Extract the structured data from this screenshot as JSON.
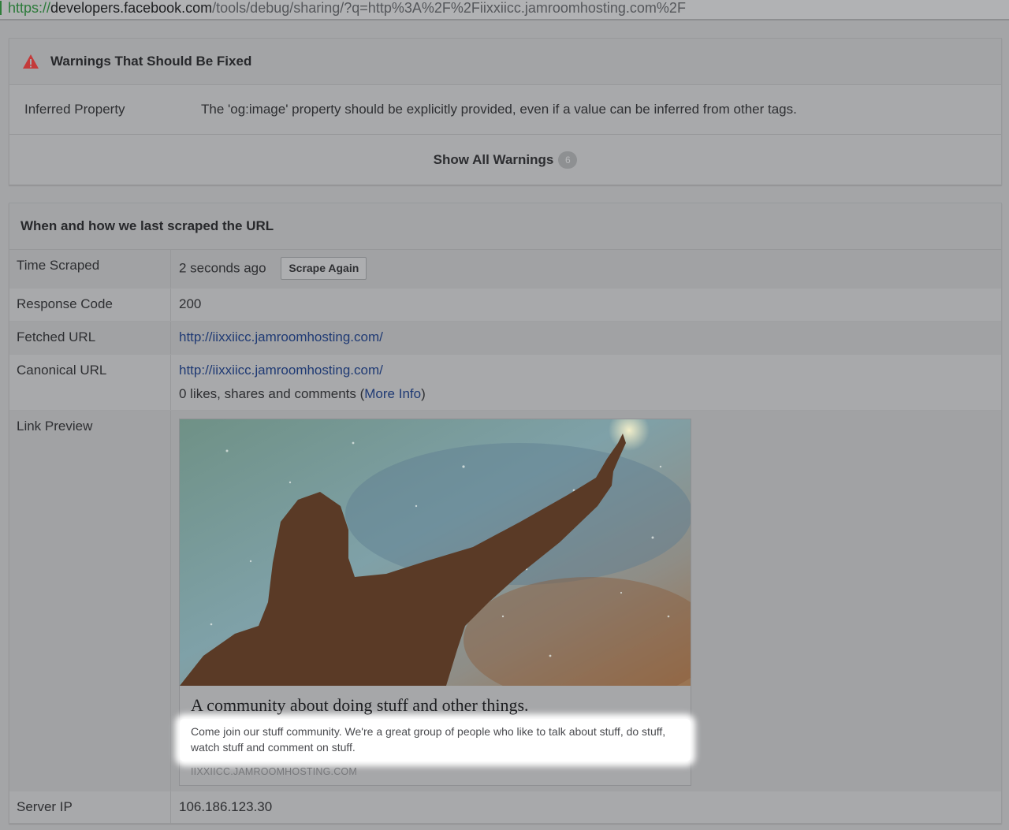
{
  "url_bar": {
    "scheme": "https://",
    "host": "developers.facebook.com",
    "path": "/tools/debug/sharing/?q=http%3A%2F%2Fiixxiicc.jamroomhosting.com%2F"
  },
  "warnings": {
    "title": "Warnings That Should Be Fixed",
    "icon": "warning-triangle-icon",
    "icon_color": "#c43a3a",
    "items": [
      {
        "label": "Inferred Property",
        "message": "The 'og:image' property should be explicitly provided, even if a value can be inferred from other tags."
      }
    ],
    "show_all_label": "Show All Warnings",
    "count": "6"
  },
  "scrape": {
    "title": "When and how we last scraped the URL",
    "time_scraped": {
      "label": "Time Scraped",
      "value": "2 seconds ago",
      "button": "Scrape Again"
    },
    "response_code": {
      "label": "Response Code",
      "value": "200"
    },
    "fetched_url": {
      "label": "Fetched URL",
      "value": "http://iixxiicc.jamroomhosting.com/"
    },
    "canonical_url": {
      "label": "Canonical URL",
      "value": "http://iixxiicc.jamroomhosting.com/",
      "likes_prefix": "0 likes, shares and comments (",
      "more_info": "More Info",
      "likes_suffix": ")"
    },
    "link_preview": {
      "label": "Link Preview",
      "title": "A community about doing stuff and other things.",
      "description": "Come join our stuff community. We're a great group of people who like to talk about stuff, do stuff, watch stuff and comment on stuff.",
      "domain": "IIXXIICC.JAMROOMHOSTING.COM"
    },
    "server_ip": {
      "label": "Server IP",
      "value": "106.186.123.30"
    }
  }
}
